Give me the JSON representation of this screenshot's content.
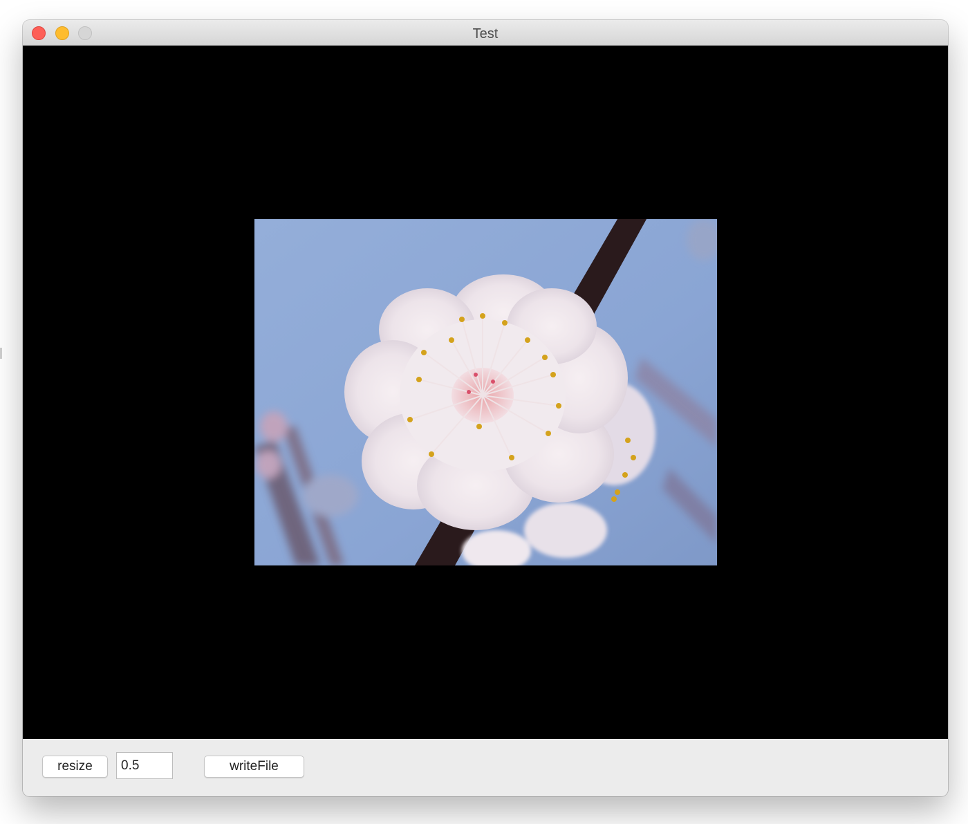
{
  "window": {
    "title": "Test"
  },
  "canvas": {
    "background": "#000000",
    "image": {
      "subject": "plum-blossom-photo",
      "sky_color": "#8fa9d6",
      "petal_color": "#f3eef0",
      "branch_color": "#2a1a1c",
      "stamen_color": "#d4a21c"
    }
  },
  "controls": {
    "resize_label": "resize",
    "scale_value": "0.5",
    "write_label": "writeFile"
  },
  "colors": {
    "close": "#fd5f57",
    "minimize": "#febc2e",
    "zoom": "#d6d6d6",
    "panel": "#ececec"
  }
}
